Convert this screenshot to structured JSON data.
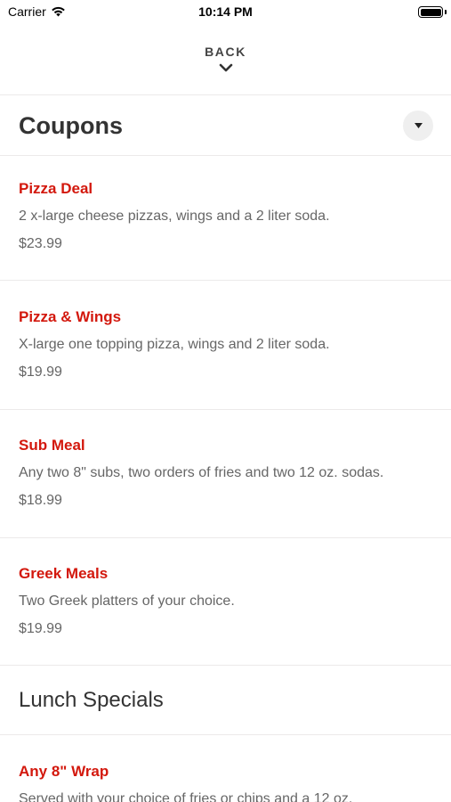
{
  "status_bar": {
    "carrier": "Carrier",
    "time": "10:14 PM"
  },
  "nav": {
    "back_label": "BACK"
  },
  "coupons": {
    "title": "Coupons",
    "items": [
      {
        "name": "Pizza Deal",
        "description": "2 x-large cheese pizzas, wings and a 2 liter soda.",
        "price": "$23.99"
      },
      {
        "name": "Pizza & Wings",
        "description": "X-large one topping pizza, wings and 2 liter soda.",
        "price": "$19.99"
      },
      {
        "name": "Sub Meal",
        "description": "Any two 8\" subs, two orders of fries and two 12 oz. sodas.",
        "price": "$18.99"
      },
      {
        "name": "Greek Meals",
        "description": "Two Greek platters of your choice.",
        "price": "$19.99"
      }
    ]
  },
  "lunch_specials": {
    "title": "Lunch Specials",
    "items": [
      {
        "name": "Any 8\" Wrap",
        "description": "Served with your choice of fries or chips and a 12 oz."
      }
    ]
  },
  "colors": {
    "item_name": "#d3180d",
    "divider": "#eceaea",
    "toggle_bg": "#efefef"
  }
}
